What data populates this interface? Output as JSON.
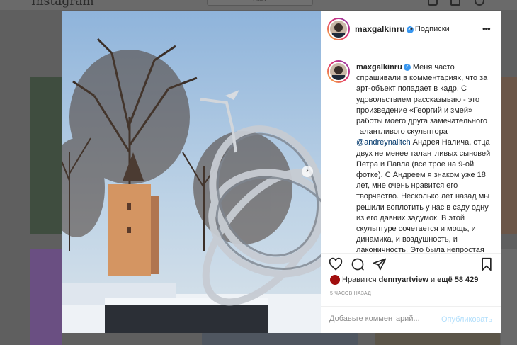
{
  "background": {
    "logo": "Instagram",
    "search_placeholder": "Поиск"
  },
  "post": {
    "author": "maxgalkinru",
    "verified": true,
    "follow_label": "• Подписки",
    "more_icon": "more-horizontal-icon",
    "caption_before_mention": "Меня часто спрашивали в комментариях, что за арт-объект попадает в кадр. С удовольствием рассказываю - это произведение «Георгий и змей» работы моего друга замечательного талантливого скульптора ",
    "mention": "@andreynalitch",
    "caption_after_mention": " Андрея Налича, отца двух не менее талантливых сыновей Петра и Павла (все трое на 9-ой фотке). С Андреем я знаком уже 18 лет, мне очень нравится его творчество. Несколько лет назад мы решили воплотить у нас в саду одну из его давних задумок. В этой скульптуре сочетается и мощь, и динамика, и воздушность, и лаконичность. Это была непростая технологическая задача, учитывая, что высота скульптуры из",
    "carousel": {
      "count": 10,
      "active_index": 0
    },
    "actions": [
      "heart-icon",
      "comment-icon",
      "share-icon",
      "bookmark-icon"
    ],
    "likes": {
      "prefix": "Нравится ",
      "user": "dennyartview",
      "middle": " и ",
      "rest": "ещё 58 429"
    },
    "time_ago": "5 ЧАСОВ НАЗАД",
    "comment_placeholder": "Добавьте комментарий...",
    "post_button": "Опубликовать"
  }
}
